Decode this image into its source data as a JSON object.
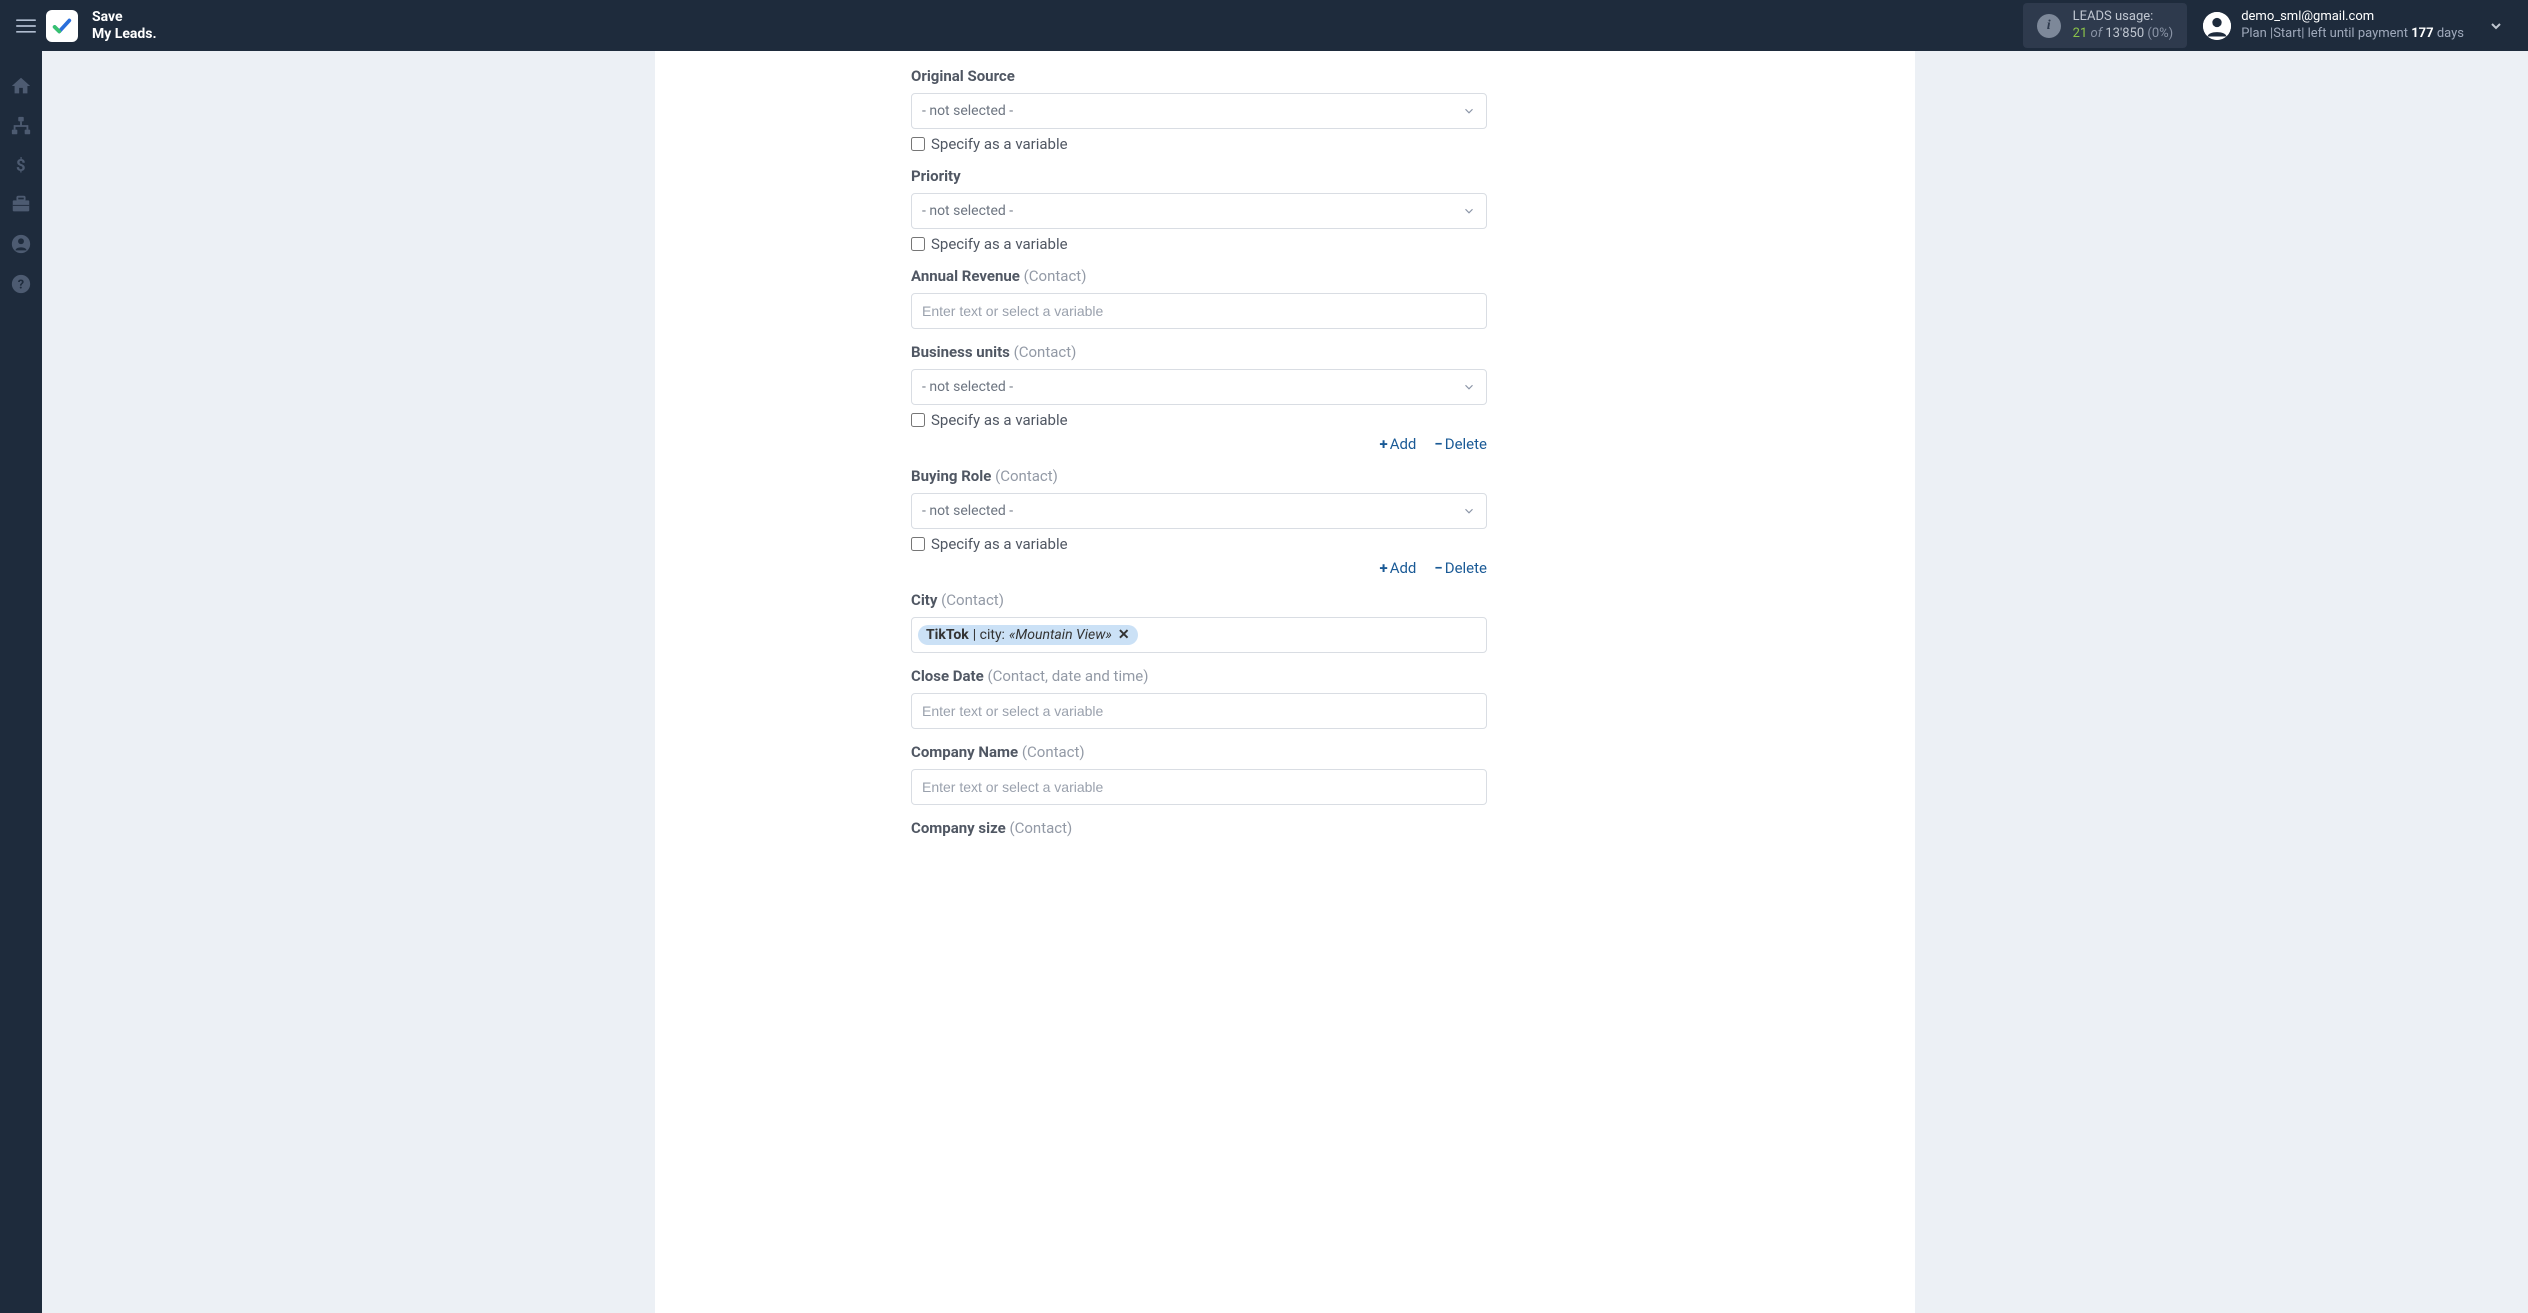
{
  "header": {
    "logo_line1": "Save",
    "logo_line2": "My Leads.",
    "leads_usage": {
      "label": "LEADS usage:",
      "used": "21",
      "of": "of",
      "total": "13'850",
      "pct": "(0%)"
    },
    "user": {
      "email": "demo_sml@gmail.com",
      "plan_prefix": "Plan |Start| left until payment ",
      "days": "177",
      "days_suffix": " days"
    }
  },
  "form": {
    "original_source": {
      "label": "Original Source",
      "value": "- not selected -",
      "checkbox_label": "Specify as a variable"
    },
    "priority": {
      "label": "Priority",
      "value": "- not selected -",
      "checkbox_label": "Specify as a variable"
    },
    "annual_revenue": {
      "label": "Annual Revenue",
      "hint": "(Contact)",
      "placeholder": "Enter text or select a variable"
    },
    "business_units": {
      "label": "Business units",
      "hint": "(Contact)",
      "value": "- not selected -",
      "checkbox_label": "Specify as a variable"
    },
    "buying_role": {
      "label": "Buying Role",
      "hint": "(Contact)",
      "value": "- not selected -",
      "checkbox_label": "Specify as a variable"
    },
    "city": {
      "label": "City",
      "hint": "(Contact)",
      "tag_source": "TikTok",
      "tag_sep": " | city: ",
      "tag_value": "«Mountain View»"
    },
    "close_date": {
      "label": "Close Date",
      "hint": "(Contact, date and time)",
      "placeholder": "Enter text or select a variable"
    },
    "company_name": {
      "label": "Company Name",
      "hint": "(Contact)",
      "placeholder": "Enter text or select a variable"
    },
    "company_size": {
      "label": "Company size",
      "hint": "(Contact)"
    }
  },
  "actions": {
    "add": "Add",
    "delete": "Delete"
  }
}
